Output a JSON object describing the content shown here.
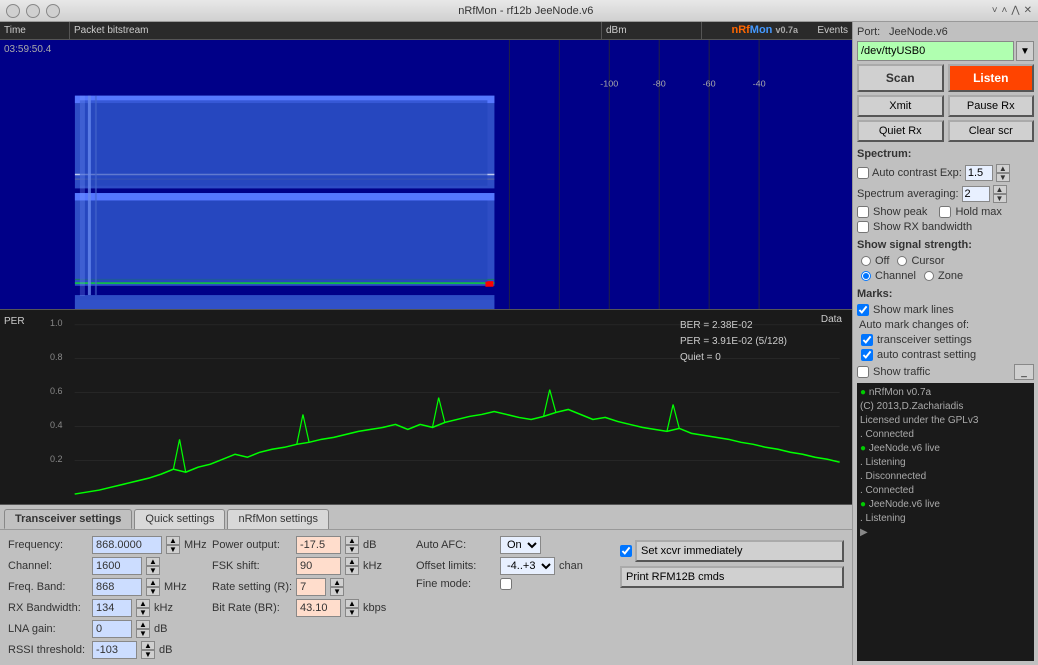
{
  "window": {
    "title": "nRfMon - rf12b JeeNode.v6"
  },
  "titlebar": {
    "close_label": "✕",
    "min_label": "─",
    "max_label": "□"
  },
  "waveform_header": {
    "time_col": "Time",
    "packet_col": "Packet bitstream",
    "dbm_col": "dBm",
    "logo": "nRfMon",
    "logo_version": "v0.7a",
    "events_col": "Events"
  },
  "waveform": {
    "time_value": "03:59:50.4"
  },
  "per_area": {
    "label": "PER",
    "data_label": "Data",
    "ber": "BER = 2.38E-02",
    "per": "PER = 3.91E-02 (5/128)",
    "quiet": "Quiet = 0",
    "y_values": [
      "1.0",
      "0.8",
      "0.6",
      "0.4",
      "0.2"
    ]
  },
  "tabs": [
    {
      "label": "Transceiver settings",
      "active": true
    },
    {
      "label": "Quick settings",
      "active": false
    },
    {
      "label": "nRfMon settings",
      "active": false
    }
  ],
  "transceiver": {
    "frequency_label": "Frequency:",
    "frequency_value": "868.0000",
    "frequency_unit": "MHz",
    "channel_label": "Channel:",
    "channel_value": "1600",
    "freq_band_label": "Freq. Band:",
    "freq_band_value": "868",
    "freq_band_unit": "MHz",
    "rx_bw_label": "RX Bandwidth:",
    "rx_bw_value": "134",
    "rx_bw_unit": "kHz",
    "lna_label": "LNA gain:",
    "lna_value": "0",
    "lna_unit": "dB",
    "rssi_label": "RSSI threshold:",
    "rssi_value": "-103",
    "rssi_unit": "dB"
  },
  "power": {
    "power_label": "Power output:",
    "power_value": "-17.5",
    "power_unit": "dB",
    "fsk_label": "FSK shift:",
    "fsk_value": "90",
    "fsk_unit": "kHz",
    "rate_label": "Rate setting (R):",
    "rate_value": "7",
    "bitrate_label": "Bit Rate (BR):",
    "bitrate_value": "43.10",
    "bitrate_unit": "kbps"
  },
  "afc": {
    "label": "Auto AFC:",
    "value": "On",
    "offset_label": "Offset limits:",
    "offset_value": "-4..+3",
    "offset_unit": "chan",
    "fine_label": "Fine mode:"
  },
  "xcvr": {
    "set_label": "Set xcvr immediately",
    "print_label": "Print RFM12B cmds"
  },
  "right_panel": {
    "port_label": "Port:",
    "port_device_label": "JeeNode.v6",
    "port_input": "/dev/ttyUSB0",
    "scan_label": "Scan",
    "listen_label": "Listen",
    "xmit_label": "Xmit",
    "pause_rx_label": "Pause Rx",
    "quiet_rx_label": "Quiet Rx",
    "clear_scr_label": "Clear scr",
    "spectrum_label": "Spectrum:",
    "auto_contrast_label": "Auto contrast",
    "exp_label": "Exp:",
    "exp_value": "1.5",
    "averaging_label": "Spectrum averaging:",
    "averaging_value": "2",
    "show_peak_label": "Show peak",
    "hold_max_label": "Hold max",
    "show_rx_bw_label": "Show RX bandwidth",
    "signal_strength_label": "Show signal strength:",
    "off_label": "Off",
    "cursor_label": "Cursor",
    "channel_label": "Channel",
    "zone_label": "Zone",
    "marks_label": "Marks:",
    "show_mark_lines_label": "Show mark lines",
    "auto_mark_label": "Auto mark changes of:",
    "transceiver_settings_label": "transceiver settings",
    "auto_contrast_setting_label": "auto contrast setting",
    "show_traffic_label": "Show traffic",
    "log_lines": [
      {
        "dot": "green",
        "text": "nRfMon v0.7a"
      },
      {
        "dot": null,
        "text": "(C) 2013,D.Zachariadis"
      },
      {
        "dot": null,
        "text": "Licensed under the GPLv3"
      },
      {
        "dot": null,
        "text": ". Connected"
      },
      {
        "dot": "green",
        "text": "JeeNode.v6 live"
      },
      {
        "dot": null,
        "text": ". Listening"
      },
      {
        "dot": null,
        "text": ". Disconnected"
      },
      {
        "dot": null,
        "text": ". Connected"
      },
      {
        "dot": "green",
        "text": "JeeNode.v6 live"
      },
      {
        "dot": null,
        "text": ". Listening"
      },
      {
        "dot": "arrow",
        "text": ""
      }
    ]
  }
}
